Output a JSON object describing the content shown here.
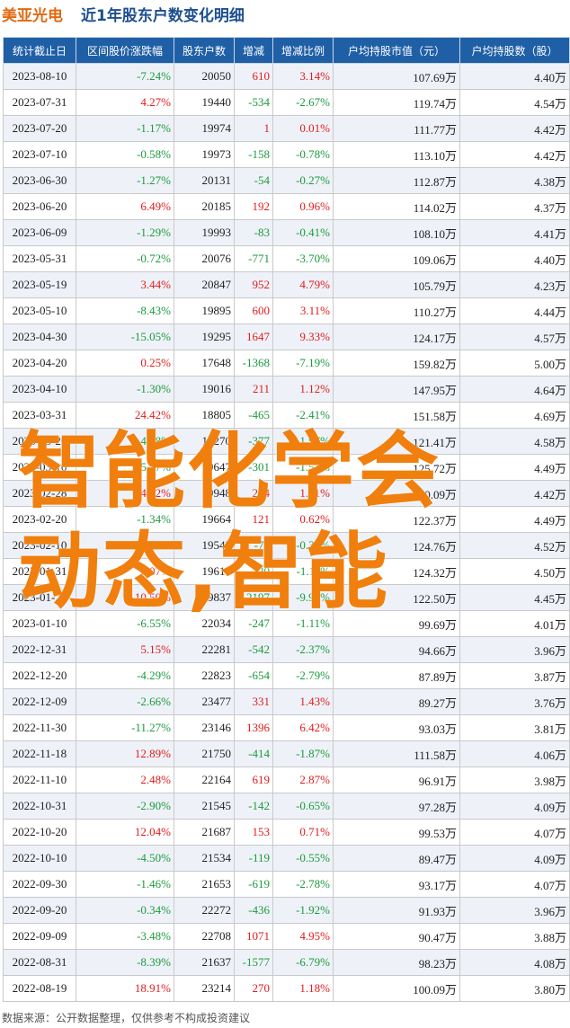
{
  "header": {
    "company": "美亚光电",
    "title": "近1年股东户数变化明细"
  },
  "columns": [
    "统计截止日",
    "区间股价涨跌幅",
    "股东户数",
    "增减",
    "增减比例",
    "户均持股市值（元）",
    "户均持股数（股）"
  ],
  "rows": [
    [
      "2023-08-10",
      "-7.24%",
      "20050",
      "610",
      "3.14%",
      "107.69万",
      "4.40万"
    ],
    [
      "2023-07-31",
      "4.27%",
      "19440",
      "-534",
      "-2.67%",
      "119.74万",
      "4.54万"
    ],
    [
      "2023-07-20",
      "-1.17%",
      "19974",
      "1",
      "0.01%",
      "111.77万",
      "4.42万"
    ],
    [
      "2023-07-10",
      "-0.58%",
      "19973",
      "-158",
      "-0.78%",
      "113.10万",
      "4.42万"
    ],
    [
      "2023-06-30",
      "-1.27%",
      "20131",
      "-54",
      "-0.27%",
      "112.87万",
      "4.38万"
    ],
    [
      "2023-06-20",
      "6.49%",
      "20185",
      "192",
      "0.96%",
      "114.02万",
      "4.37万"
    ],
    [
      "2023-06-09",
      "-1.29%",
      "19993",
      "-83",
      "-0.41%",
      "108.10万",
      "4.41万"
    ],
    [
      "2023-05-31",
      "-0.72%",
      "20076",
      "-771",
      "-3.70%",
      "109.06万",
      "4.40万"
    ],
    [
      "2023-05-19",
      "3.44%",
      "20847",
      "952",
      "4.79%",
      "105.79万",
      "4.23万"
    ],
    [
      "2023-05-10",
      "-8.43%",
      "19895",
      "600",
      "3.11%",
      "110.27万",
      "4.44万"
    ],
    [
      "2023-04-30",
      "-15.05%",
      "19295",
      "1647",
      "9.33%",
      "124.17万",
      "4.57万"
    ],
    [
      "2023-04-20",
      "0.25%",
      "17648",
      "-1368",
      "-7.19%",
      "159.82万",
      "5.00万"
    ],
    [
      "2023-04-10",
      "-1.30%",
      "19016",
      "211",
      "1.12%",
      "147.95万",
      "4.64万"
    ],
    [
      "2023-03-31",
      "24.42%",
      "18805",
      "-465",
      "-2.41%",
      "151.58万",
      "4.69万"
    ],
    [
      "2023-03-20",
      "-4.18%",
      "19270",
      "-377",
      "-1.97%",
      "121.41万",
      "4.58万"
    ],
    [
      "2023-03-10",
      "-5.37%",
      "19647",
      "-301",
      "-1.51%",
      "125.72万",
      "4.49万"
    ],
    [
      "2023-02-28",
      "4.22%",
      "19948",
      "284",
      "1.81%",
      "130.09万",
      "4.42万"
    ],
    [
      "2023-02-20",
      "-1.34%",
      "19664",
      "121",
      "0.62%",
      "122.37万",
      "4.49万"
    ],
    [
      "2023-02-10",
      "0.00%",
      "19543",
      "-74",
      "-0.38%",
      "124.76万",
      "4.52万"
    ],
    [
      "2023-01-31",
      "0.07%",
      "19617",
      "-220",
      "-1.11%",
      "124.32万",
      "4.50万"
    ],
    [
      "2023-01-20",
      "10.50%",
      "19837",
      "-2197",
      "-9.97%",
      "122.50万",
      "4.45万"
    ],
    [
      "2023-01-10",
      "-6.55%",
      "22034",
      "-247",
      "-1.11%",
      "99.69万",
      "4.01万"
    ],
    [
      "2022-12-31",
      "5.15%",
      "22281",
      "-542",
      "-2.37%",
      "94.66万",
      "3.96万"
    ],
    [
      "2022-12-20",
      "-4.29%",
      "22823",
      "-654",
      "-2.79%",
      "87.89万",
      "3.87万"
    ],
    [
      "2022-12-09",
      "-2.66%",
      "23477",
      "331",
      "1.43%",
      "89.27万",
      "3.76万"
    ],
    [
      "2022-11-30",
      "-11.27%",
      "23146",
      "1396",
      "6.42%",
      "93.03万",
      "3.81万"
    ],
    [
      "2022-11-18",
      "12.89%",
      "21750",
      "-414",
      "-1.87%",
      "111.58万",
      "4.06万"
    ],
    [
      "2022-11-10",
      "2.48%",
      "22164",
      "619",
      "2.87%",
      "96.91万",
      "3.98万"
    ],
    [
      "2022-10-31",
      "-2.90%",
      "21545",
      "-142",
      "-0.65%",
      "97.28万",
      "4.09万"
    ],
    [
      "2022-10-20",
      "12.04%",
      "21687",
      "153",
      "0.71%",
      "99.53万",
      "4.07万"
    ],
    [
      "2022-10-10",
      "-4.50%",
      "21534",
      "-119",
      "-0.55%",
      "89.47万",
      "4.09万"
    ],
    [
      "2022-09-30",
      "-1.46%",
      "21653",
      "-619",
      "-2.78%",
      "93.17万",
      "4.07万"
    ],
    [
      "2022-09-20",
      "-0.34%",
      "22272",
      "-436",
      "-1.92%",
      "91.93万",
      "3.96万"
    ],
    [
      "2022-09-09",
      "-3.48%",
      "22708",
      "1071",
      "4.95%",
      "90.47万",
      "3.88万"
    ],
    [
      "2022-08-31",
      "-8.39%",
      "21637",
      "-1577",
      "-6.79%",
      "98.23万",
      "4.08万"
    ],
    [
      "2022-08-19",
      "18.91%",
      "23214",
      "270",
      "1.18%",
      "100.09万",
      "3.80万"
    ]
  ],
  "footer": "数据来源：公开数据整理，仅供参考不构成投资建议",
  "overlay": {
    "line1": "智能化学会",
    "line2": "动态,智能"
  },
  "colors": {
    "header_bg": "#1f5fa6",
    "up": "#e31b1b",
    "down": "#1c9a3c",
    "overlay": "#f07f0e"
  }
}
